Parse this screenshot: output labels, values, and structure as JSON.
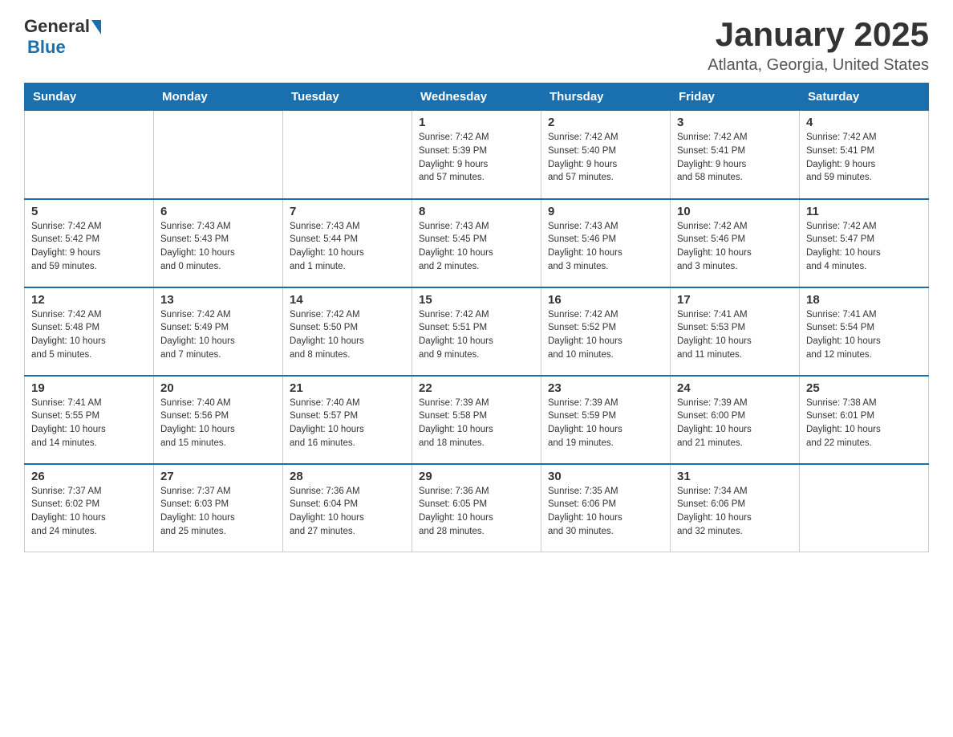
{
  "logo": {
    "text_general": "General",
    "text_blue": "Blue",
    "alt": "GeneralBlue logo"
  },
  "title": "January 2025",
  "location": "Atlanta, Georgia, United States",
  "days_of_week": [
    "Sunday",
    "Monday",
    "Tuesday",
    "Wednesday",
    "Thursday",
    "Friday",
    "Saturday"
  ],
  "weeks": [
    [
      {
        "day": "",
        "info": ""
      },
      {
        "day": "",
        "info": ""
      },
      {
        "day": "",
        "info": ""
      },
      {
        "day": "1",
        "info": "Sunrise: 7:42 AM\nSunset: 5:39 PM\nDaylight: 9 hours\nand 57 minutes."
      },
      {
        "day": "2",
        "info": "Sunrise: 7:42 AM\nSunset: 5:40 PM\nDaylight: 9 hours\nand 57 minutes."
      },
      {
        "day": "3",
        "info": "Sunrise: 7:42 AM\nSunset: 5:41 PM\nDaylight: 9 hours\nand 58 minutes."
      },
      {
        "day": "4",
        "info": "Sunrise: 7:42 AM\nSunset: 5:41 PM\nDaylight: 9 hours\nand 59 minutes."
      }
    ],
    [
      {
        "day": "5",
        "info": "Sunrise: 7:42 AM\nSunset: 5:42 PM\nDaylight: 9 hours\nand 59 minutes."
      },
      {
        "day": "6",
        "info": "Sunrise: 7:43 AM\nSunset: 5:43 PM\nDaylight: 10 hours\nand 0 minutes."
      },
      {
        "day": "7",
        "info": "Sunrise: 7:43 AM\nSunset: 5:44 PM\nDaylight: 10 hours\nand 1 minute."
      },
      {
        "day": "8",
        "info": "Sunrise: 7:43 AM\nSunset: 5:45 PM\nDaylight: 10 hours\nand 2 minutes."
      },
      {
        "day": "9",
        "info": "Sunrise: 7:43 AM\nSunset: 5:46 PM\nDaylight: 10 hours\nand 3 minutes."
      },
      {
        "day": "10",
        "info": "Sunrise: 7:42 AM\nSunset: 5:46 PM\nDaylight: 10 hours\nand 3 minutes."
      },
      {
        "day": "11",
        "info": "Sunrise: 7:42 AM\nSunset: 5:47 PM\nDaylight: 10 hours\nand 4 minutes."
      }
    ],
    [
      {
        "day": "12",
        "info": "Sunrise: 7:42 AM\nSunset: 5:48 PM\nDaylight: 10 hours\nand 5 minutes."
      },
      {
        "day": "13",
        "info": "Sunrise: 7:42 AM\nSunset: 5:49 PM\nDaylight: 10 hours\nand 7 minutes."
      },
      {
        "day": "14",
        "info": "Sunrise: 7:42 AM\nSunset: 5:50 PM\nDaylight: 10 hours\nand 8 minutes."
      },
      {
        "day": "15",
        "info": "Sunrise: 7:42 AM\nSunset: 5:51 PM\nDaylight: 10 hours\nand 9 minutes."
      },
      {
        "day": "16",
        "info": "Sunrise: 7:42 AM\nSunset: 5:52 PM\nDaylight: 10 hours\nand 10 minutes."
      },
      {
        "day": "17",
        "info": "Sunrise: 7:41 AM\nSunset: 5:53 PM\nDaylight: 10 hours\nand 11 minutes."
      },
      {
        "day": "18",
        "info": "Sunrise: 7:41 AM\nSunset: 5:54 PM\nDaylight: 10 hours\nand 12 minutes."
      }
    ],
    [
      {
        "day": "19",
        "info": "Sunrise: 7:41 AM\nSunset: 5:55 PM\nDaylight: 10 hours\nand 14 minutes."
      },
      {
        "day": "20",
        "info": "Sunrise: 7:40 AM\nSunset: 5:56 PM\nDaylight: 10 hours\nand 15 minutes."
      },
      {
        "day": "21",
        "info": "Sunrise: 7:40 AM\nSunset: 5:57 PM\nDaylight: 10 hours\nand 16 minutes."
      },
      {
        "day": "22",
        "info": "Sunrise: 7:39 AM\nSunset: 5:58 PM\nDaylight: 10 hours\nand 18 minutes."
      },
      {
        "day": "23",
        "info": "Sunrise: 7:39 AM\nSunset: 5:59 PM\nDaylight: 10 hours\nand 19 minutes."
      },
      {
        "day": "24",
        "info": "Sunrise: 7:39 AM\nSunset: 6:00 PM\nDaylight: 10 hours\nand 21 minutes."
      },
      {
        "day": "25",
        "info": "Sunrise: 7:38 AM\nSunset: 6:01 PM\nDaylight: 10 hours\nand 22 minutes."
      }
    ],
    [
      {
        "day": "26",
        "info": "Sunrise: 7:37 AM\nSunset: 6:02 PM\nDaylight: 10 hours\nand 24 minutes."
      },
      {
        "day": "27",
        "info": "Sunrise: 7:37 AM\nSunset: 6:03 PM\nDaylight: 10 hours\nand 25 minutes."
      },
      {
        "day": "28",
        "info": "Sunrise: 7:36 AM\nSunset: 6:04 PM\nDaylight: 10 hours\nand 27 minutes."
      },
      {
        "day": "29",
        "info": "Sunrise: 7:36 AM\nSunset: 6:05 PM\nDaylight: 10 hours\nand 28 minutes."
      },
      {
        "day": "30",
        "info": "Sunrise: 7:35 AM\nSunset: 6:06 PM\nDaylight: 10 hours\nand 30 minutes."
      },
      {
        "day": "31",
        "info": "Sunrise: 7:34 AM\nSunset: 6:06 PM\nDaylight: 10 hours\nand 32 minutes."
      },
      {
        "day": "",
        "info": ""
      }
    ]
  ]
}
